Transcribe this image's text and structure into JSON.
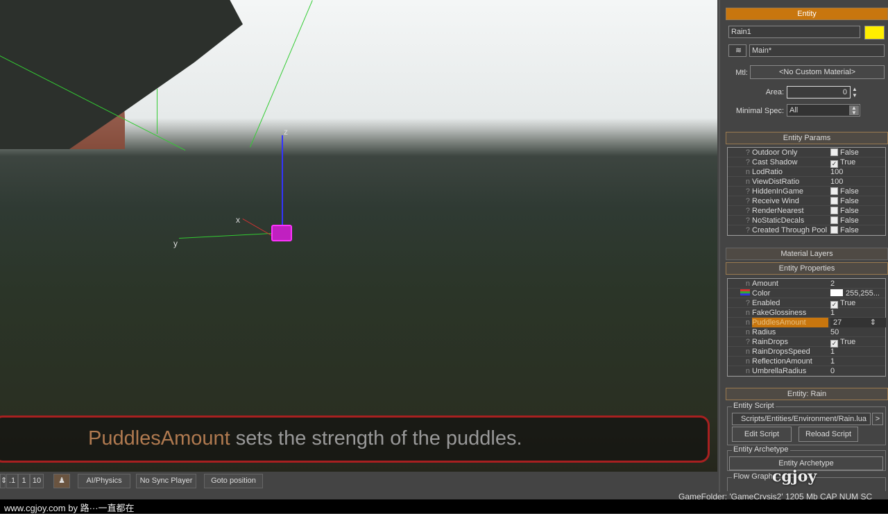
{
  "viewport": {
    "axis_x": "x",
    "axis_y": "y",
    "axis_z": "z",
    "subtitle_highlight": "PuddlesAmount",
    "subtitle_rest": " sets the strength of the puddles."
  },
  "toolbar": {
    "step_small": ".1",
    "step_one": "1",
    "step_ten": "10",
    "ai_physics": "AI/Physics",
    "no_sync_player": "No Sync Player",
    "goto_position": "Goto position"
  },
  "status": {
    "text": "GameFolder: 'GameCrysis2'   1205 Mb   CAP   NUM   SC"
  },
  "footer": {
    "text": "www.cgjoy.com by 路···一直都在"
  },
  "watermark": "cgjoy 游戏动画特效论坛 www.cgjoy.com",
  "panel": {
    "entity_header": "Entity",
    "name": "Rain1",
    "color": "#ffee00",
    "layer": "Main*",
    "mtl_label": "Mtl:",
    "mtl": "<No Custom Material>",
    "area_label": "Area:",
    "area": "0",
    "minspec_label": "Minimal Spec:",
    "minspec": "All",
    "params_header": "Entity Params",
    "params": [
      {
        "t": "?",
        "n": "Outdoor Only",
        "v": "False",
        "cb": false
      },
      {
        "t": "?",
        "n": "Cast Shadow",
        "v": "True",
        "cb": true
      },
      {
        "t": "n",
        "n": "LodRatio",
        "v": "100"
      },
      {
        "t": "n",
        "n": "ViewDistRatio",
        "v": "100"
      },
      {
        "t": "?",
        "n": "HiddenInGame",
        "v": "False",
        "cb": false
      },
      {
        "t": "?",
        "n": "Receive Wind",
        "v": "False",
        "cb": false
      },
      {
        "t": "?",
        "n": "RenderNearest",
        "v": "False",
        "cb": false
      },
      {
        "t": "?",
        "n": "NoStaticDecals",
        "v": "False",
        "cb": false
      },
      {
        "t": "?",
        "n": "Created Through Pool",
        "v": "False",
        "cb": false
      }
    ],
    "material_layers": "Material Layers",
    "props_header": "Entity Properties",
    "props": [
      {
        "t": "n",
        "n": "Amount",
        "v": "2"
      },
      {
        "t": "c",
        "n": "Color",
        "v": "255,255..."
      },
      {
        "t": "?",
        "n": "Enabled",
        "v": "True",
        "cb": true
      },
      {
        "t": "n",
        "n": "FakeGlossiness",
        "v": "1"
      },
      {
        "t": "n",
        "n": "PuddlesAmount",
        "v": "27",
        "sel": true
      },
      {
        "t": "n",
        "n": "Radius",
        "v": "50"
      },
      {
        "t": "?",
        "n": "RainDrops",
        "v": "True",
        "cb": true
      },
      {
        "t": "n",
        "n": "RainDropsSpeed",
        "v": "1"
      },
      {
        "t": "n",
        "n": "ReflectionAmount",
        "v": "1"
      },
      {
        "t": "n",
        "n": "UmbrellaRadius",
        "v": "0"
      }
    ],
    "rain_header": "Entity: Rain",
    "script_group": "Entity Script",
    "script_path": "Scripts/Entities/Environment/Rain.lua",
    "script_go": ">",
    "edit_script": "Edit Script",
    "reload_script": "Reload Script",
    "archetype_group": "Entity Archetype",
    "archetype_btn": "Entity Archetype",
    "flowgraph_group": "Flow Graph"
  }
}
